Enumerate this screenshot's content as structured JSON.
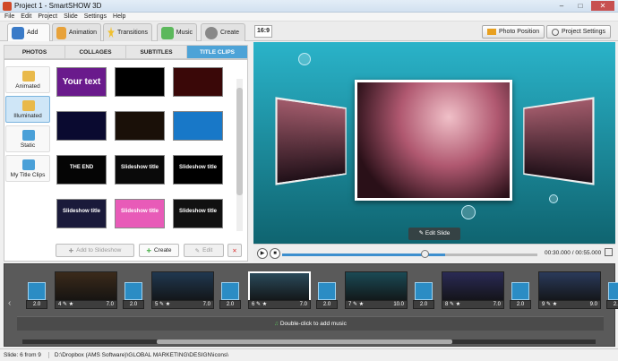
{
  "window": {
    "title": "Project 1 - SmartSHOW 3D"
  },
  "menu": [
    "File",
    "Edit",
    "Project",
    "Slide",
    "Settings",
    "Help"
  ],
  "tabs": [
    {
      "label": "Add"
    },
    {
      "label": "Animation"
    },
    {
      "label": "Transitions"
    },
    {
      "label": "Music"
    },
    {
      "label": "Create"
    }
  ],
  "toolbar": {
    "ratio": "16:9",
    "photo_position": "Photo Position",
    "project_settings": "Project Settings"
  },
  "subtabs": [
    "PHOTOS",
    "COLLAGES",
    "SUBTITLES",
    "TITLE CLIPS"
  ],
  "categories": [
    "Animated",
    "Illuminated",
    "Static",
    "My Title Clips"
  ],
  "thumbs": [
    {
      "text": "Your text",
      "bg": "#6a1a8c"
    },
    {
      "text": "",
      "bg": "#000"
    },
    {
      "text": "",
      "bg": "#3a0808"
    },
    {
      "text": "",
      "bg": "#0a0a30"
    },
    {
      "text": "",
      "bg": "#1a1008"
    },
    {
      "text": "",
      "bg": "#1878c8"
    },
    {
      "text": "THE END",
      "bg": "#050505"
    },
    {
      "text": "Slideshow title",
      "bg": "#0a0a0a"
    },
    {
      "text": "Slideshow title",
      "bg": "#000"
    },
    {
      "text": "Slideshow title",
      "bg": "#1a1a3a"
    },
    {
      "text": "Slideshow title",
      "bg": "#e85bb8"
    },
    {
      "text": "Slideshow title",
      "bg": "#111"
    }
  ],
  "actions": {
    "add_to_slideshow": "Add to Slideshow",
    "create": "Create",
    "edit": "Edit"
  },
  "preview": {
    "edit_slide": "Edit Slide",
    "time": "00:30.000 / 00:55.000"
  },
  "timeline": {
    "slides": [
      {
        "n": "4",
        "d": "7.0",
        "bg": "#3b2a1a"
      },
      {
        "n": "5",
        "d": "7.0",
        "bg": "#203850"
      },
      {
        "n": "6",
        "d": "7.0",
        "bg": "#2a4a5a"
      },
      {
        "n": "7",
        "d": "10.0",
        "bg": "#1a4a55"
      },
      {
        "n": "8",
        "d": "7.0",
        "bg": "#2a2a55"
      },
      {
        "n": "9",
        "d": "9.0",
        "bg": "#2a3a5a"
      }
    ],
    "transition_duration": "2.0",
    "music_hint": "Double-click to add music"
  },
  "status": {
    "slide": "Slide: 6 from 9",
    "path": "D:\\Dropbox (AMS Software)\\GLOBAL MARKETING\\DESIGN\\icons\\"
  }
}
